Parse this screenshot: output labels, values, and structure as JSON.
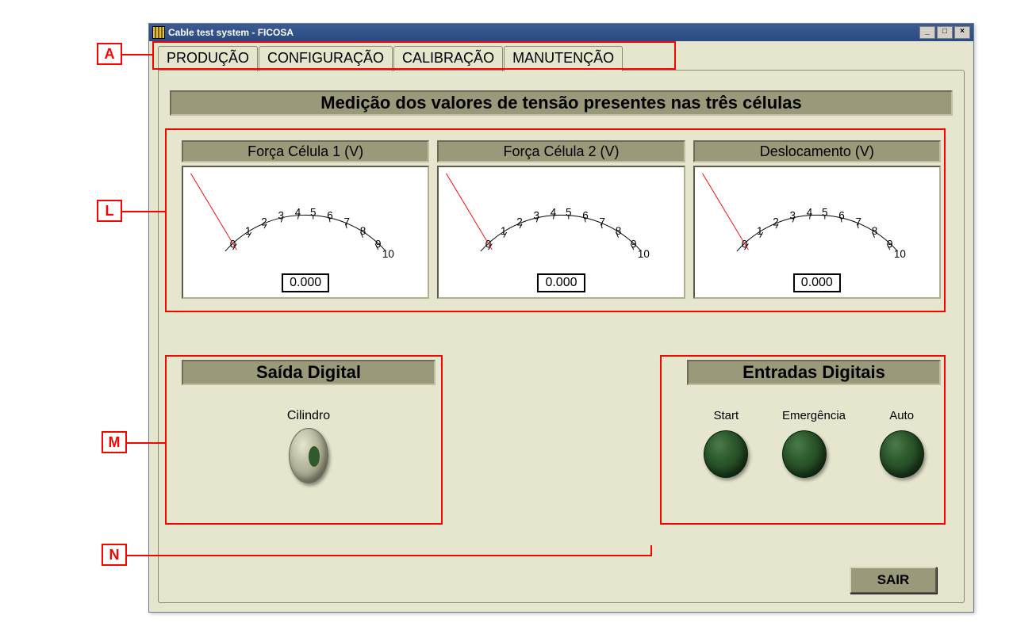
{
  "window": {
    "title": "Cable test system - FICOSA"
  },
  "tabs": [
    "PRODUÇÃO",
    "CONFIGURAÇÃO",
    "CALIBRAÇÃO",
    "MANUTENÇÃO"
  ],
  "active_tab_index": 3,
  "heading": "Medição dos valores de tensão presentes nas três células",
  "gauges": [
    {
      "title": "Força Célula 1 (V)",
      "value": "0.000",
      "scale": [
        "0",
        "1",
        "2",
        "3",
        "4",
        "5",
        "6",
        "7",
        "8",
        "9",
        "10"
      ]
    },
    {
      "title": "Força Célula 2 (V)",
      "value": "0.000",
      "scale": [
        "0",
        "1",
        "2",
        "3",
        "4",
        "5",
        "6",
        "7",
        "8",
        "9",
        "10"
      ]
    },
    {
      "title": "Deslocamento (V)",
      "value": "0.000",
      "scale": [
        "0",
        "1",
        "2",
        "3",
        "4",
        "5",
        "6",
        "7",
        "8",
        "9",
        "10"
      ]
    }
  ],
  "digital_output": {
    "heading": "Saída Digital",
    "toggle_label": "Cilindro"
  },
  "digital_inputs": {
    "heading": "Entradas Digitais",
    "leds": [
      "Start",
      "Emergência",
      "Auto"
    ]
  },
  "exit_button": "SAIR",
  "annotations": [
    "A",
    "L",
    "M",
    "N"
  ]
}
